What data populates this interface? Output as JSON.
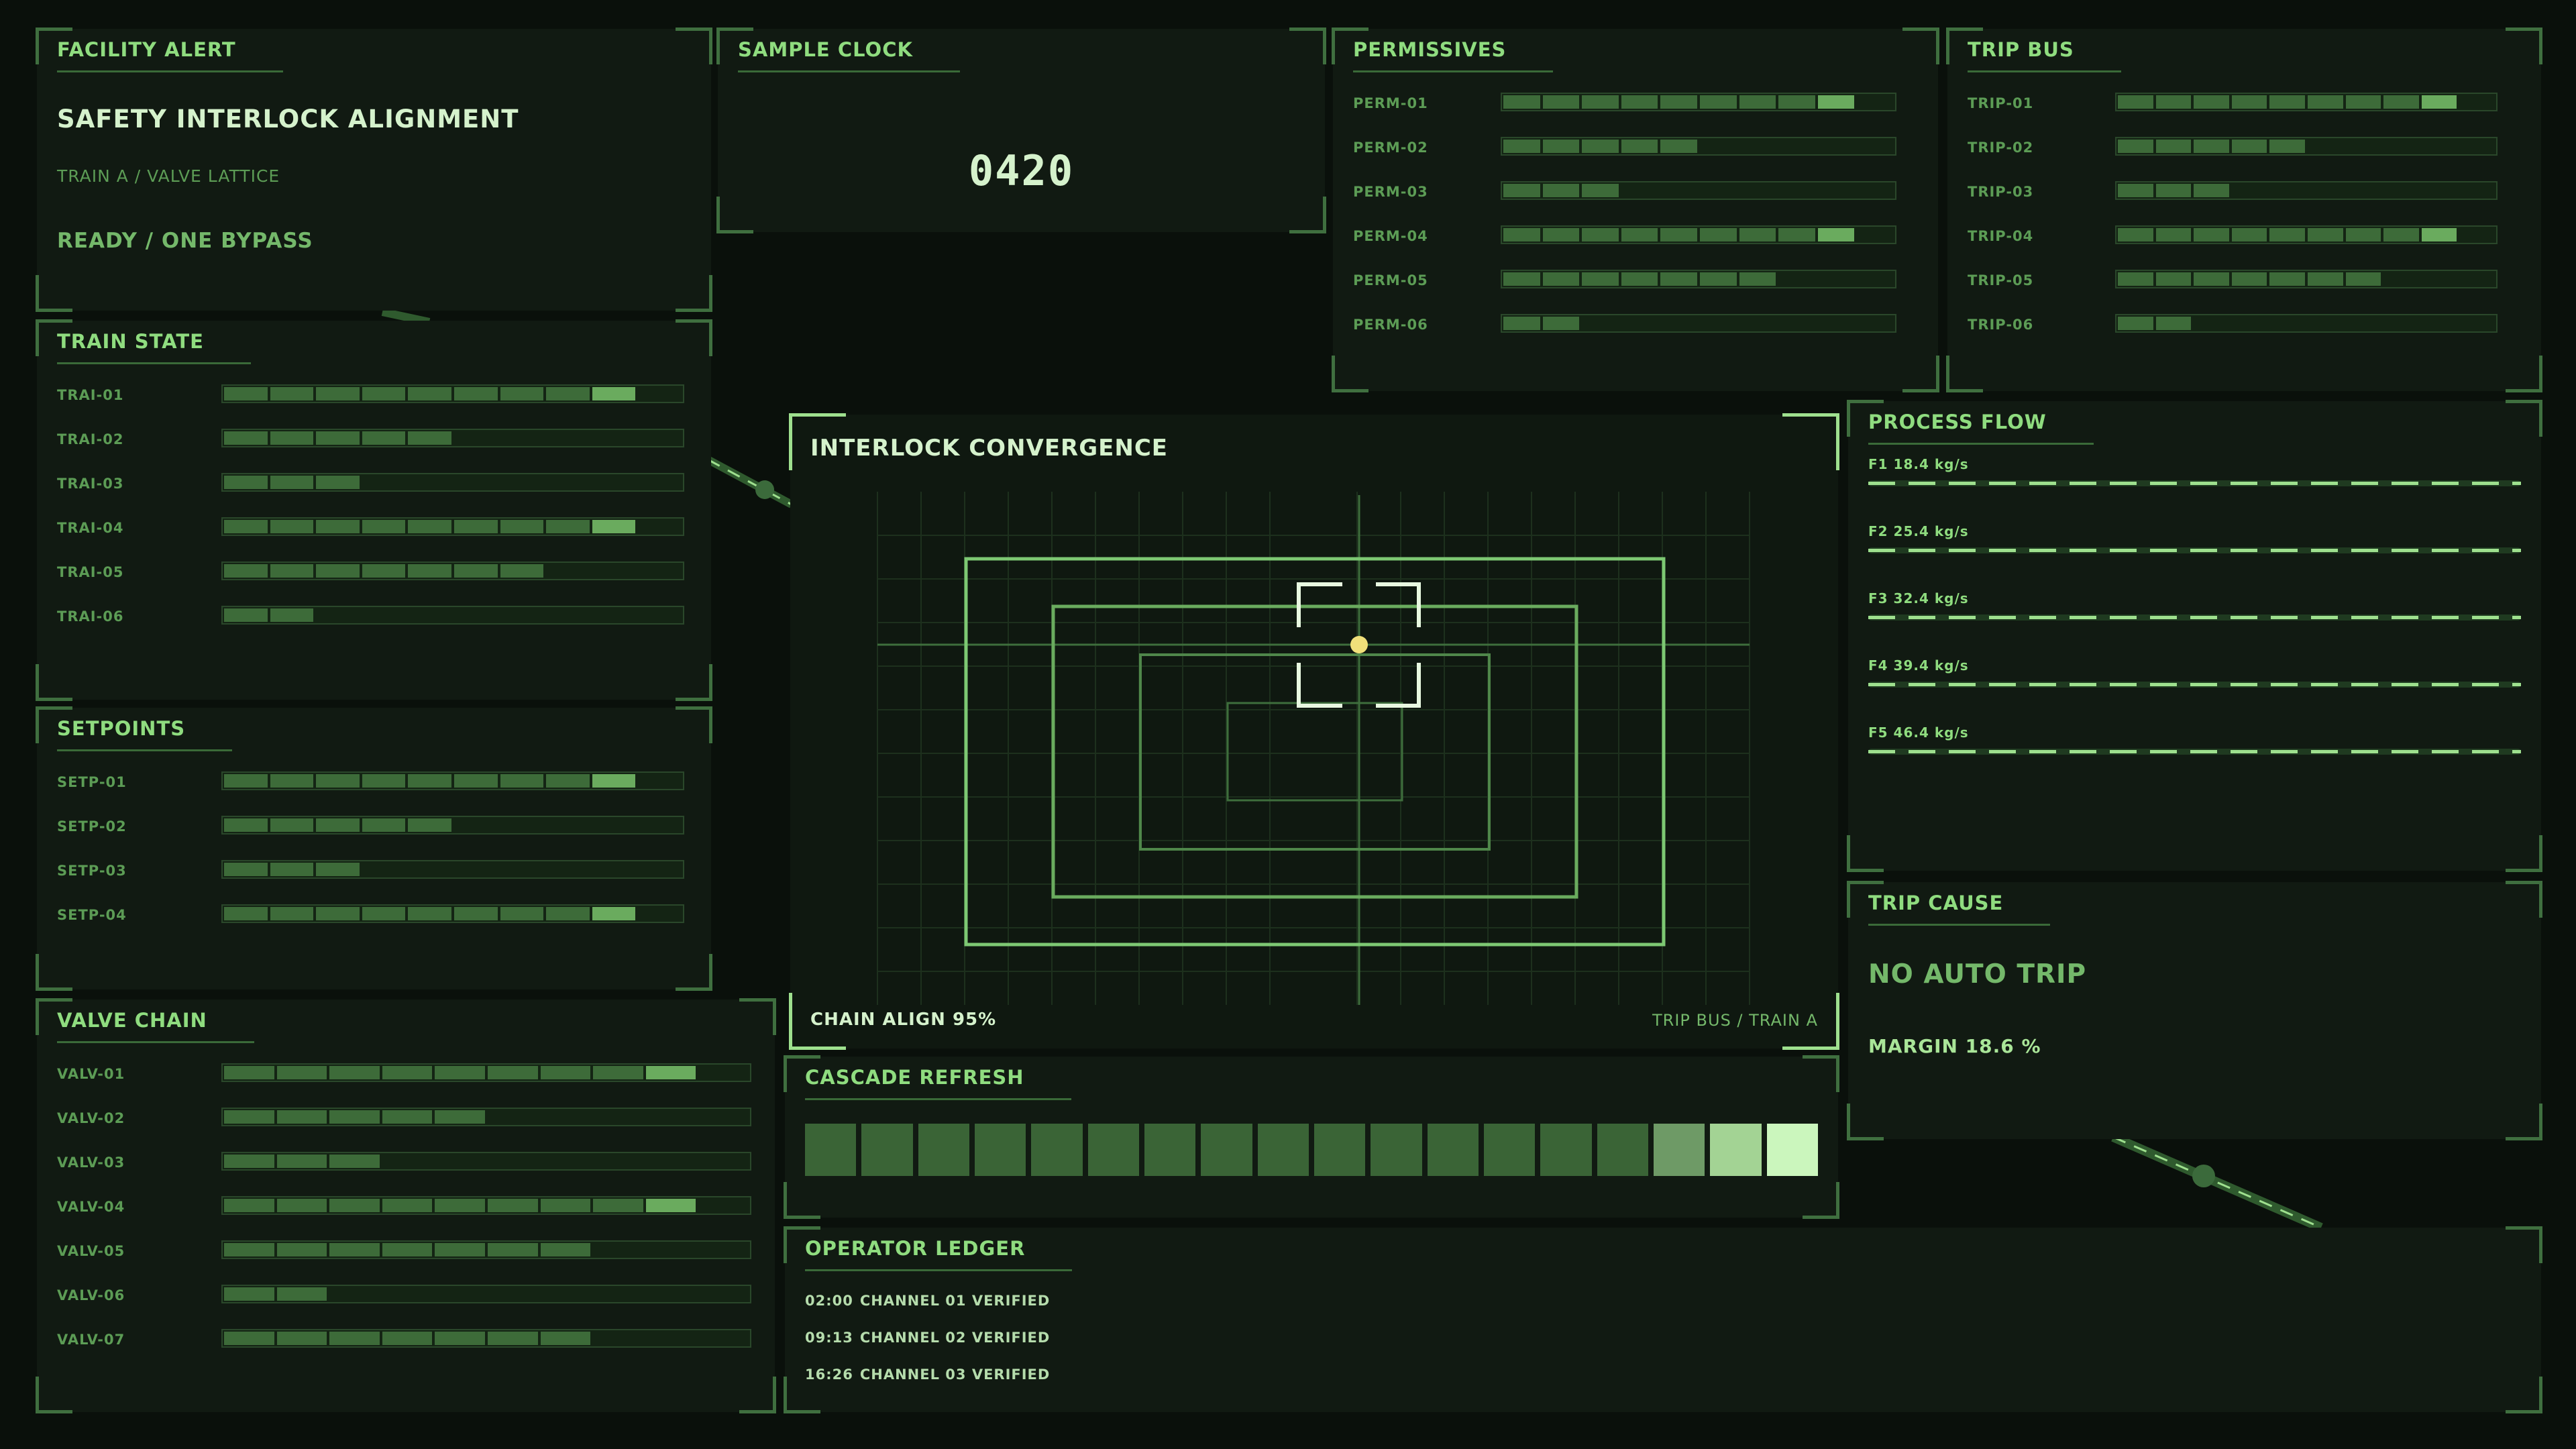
{
  "colors": {
    "background": "#0a100b",
    "panel": "#111a12",
    "accent": "#8fdc7f",
    "segment_on": "#3d6b39",
    "segment_highlight": "#6aab5e",
    "marker": "#f0e07a"
  },
  "facility_alert": {
    "title": "FACILITY ALERT",
    "headline": "SAFETY INTERLOCK ALIGNMENT",
    "subline": "TRAIN A / VALVE LATTICE",
    "status": "READY / ONE BYPASS"
  },
  "sample_clock": {
    "title": "SAMPLE CLOCK",
    "value": "0420"
  },
  "train_state": {
    "title": "TRAIN STATE",
    "rows": [
      {
        "label": "TRAI-01",
        "level": 9,
        "highlight": true
      },
      {
        "label": "TRAI-02",
        "level": 5,
        "highlight": false
      },
      {
        "label": "TRAI-03",
        "level": 3,
        "highlight": false
      },
      {
        "label": "TRAI-04",
        "level": 9,
        "highlight": true
      },
      {
        "label": "TRAI-05",
        "level": 7,
        "highlight": false
      },
      {
        "label": "TRAI-06",
        "level": 2,
        "highlight": false
      }
    ],
    "segments": 10
  },
  "setpoints": {
    "title": "SETPOINTS",
    "rows": [
      {
        "label": "SETP-01",
        "level": 9,
        "highlight": true
      },
      {
        "label": "SETP-02",
        "level": 5,
        "highlight": false
      },
      {
        "label": "SETP-03",
        "level": 3,
        "highlight": false
      },
      {
        "label": "SETP-04",
        "level": 9,
        "highlight": true
      }
    ],
    "segments": 10
  },
  "valve_chain": {
    "title": "VALVE CHAIN",
    "rows": [
      {
        "label": "VALV-01",
        "level": 9,
        "highlight": true
      },
      {
        "label": "VALV-02",
        "level": 5,
        "highlight": false
      },
      {
        "label": "VALV-03",
        "level": 3,
        "highlight": false
      },
      {
        "label": "VALV-04",
        "level": 9,
        "highlight": true
      },
      {
        "label": "VALV-05",
        "level": 7,
        "highlight": false
      },
      {
        "label": "VALV-06",
        "level": 2,
        "highlight": false
      },
      {
        "label": "VALV-07",
        "level": 7,
        "highlight": false
      }
    ],
    "segments": 10
  },
  "permissives": {
    "title": "PERMISSIVES",
    "rows": [
      {
        "label": "PERM-01",
        "level": 9,
        "highlight": true
      },
      {
        "label": "PERM-02",
        "level": 5,
        "highlight": false
      },
      {
        "label": "PERM-03",
        "level": 3,
        "highlight": false
      },
      {
        "label": "PERM-04",
        "level": 9,
        "highlight": true
      },
      {
        "label": "PERM-05",
        "level": 7,
        "highlight": false
      },
      {
        "label": "PERM-06",
        "level": 2,
        "highlight": false
      }
    ],
    "segments": 10
  },
  "trip_bus": {
    "title": "TRIP BUS",
    "rows": [
      {
        "label": "TRIP-01",
        "level": 9,
        "highlight": true
      },
      {
        "label": "TRIP-02",
        "level": 5,
        "highlight": false
      },
      {
        "label": "TRIP-03",
        "level": 3,
        "highlight": false
      },
      {
        "label": "TRIP-04",
        "level": 9,
        "highlight": true
      },
      {
        "label": "TRIP-05",
        "level": 7,
        "highlight": false
      },
      {
        "label": "TRIP-06",
        "level": 2,
        "highlight": false
      }
    ],
    "segments": 10
  },
  "convergence": {
    "title": "INTERLOCK CONVERGENCE",
    "footer_left": "CHAIN ALIGN 95%",
    "footer_right": "TRIP BUS / TRAIN A"
  },
  "process_flow": {
    "title": "PROCESS FLOW",
    "rows": [
      {
        "label": "F1  18.4 kg/s"
      },
      {
        "label": "F2  25.4 kg/s"
      },
      {
        "label": "F3  32.4 kg/s"
      },
      {
        "label": "F4  39.4 kg/s"
      },
      {
        "label": "F5  46.4 kg/s"
      }
    ]
  },
  "trip_cause": {
    "title": "TRIP CAUSE",
    "status": "NO AUTO TRIP",
    "margin": "MARGIN  18.6 %"
  },
  "cascade_refresh": {
    "title": "CASCADE REFRESH",
    "cells": 18,
    "lit_cells": [
      {
        "index": 15,
        "color": "#6e9a66"
      },
      {
        "index": 16,
        "color": "#a3d394"
      },
      {
        "index": 17,
        "color": "#cbf6bd"
      }
    ]
  },
  "operator_ledger": {
    "title": "OPERATOR LEDGER",
    "entries": [
      {
        "time": "02:00",
        "text": "CHANNEL 01 VERIFIED"
      },
      {
        "time": "09:13",
        "text": "CHANNEL 02 VERIFIED"
      },
      {
        "time": "16:26",
        "text": "CHANNEL 03 VERIFIED"
      }
    ]
  }
}
